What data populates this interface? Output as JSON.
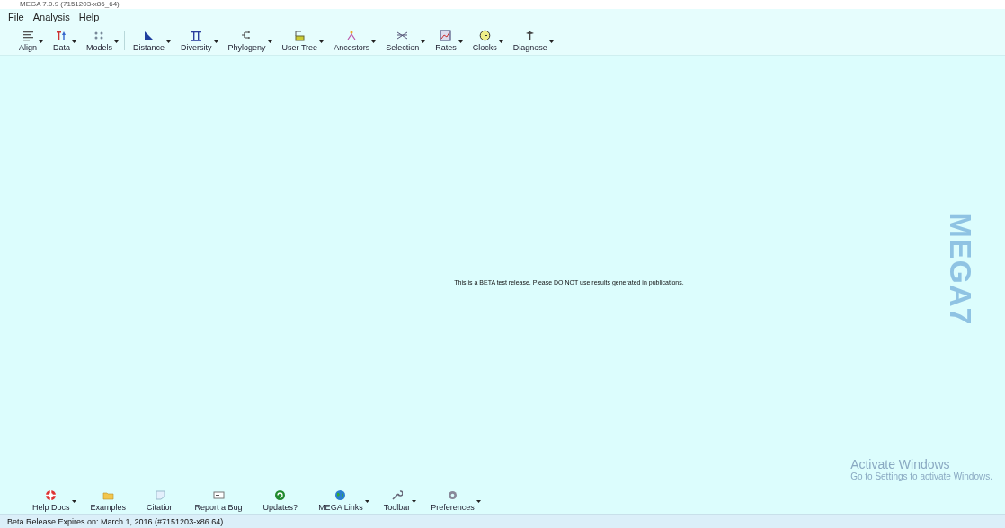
{
  "window": {
    "title": "MEGA 7.0.9 (7151203-x86_64)"
  },
  "menu": [
    "File",
    "Analysis",
    "Help"
  ],
  "toolbar": [
    {
      "label": "Align",
      "dropdown": true,
      "separator_after": false
    },
    {
      "label": "Data",
      "dropdown": true,
      "separator_after": false
    },
    {
      "label": "Models",
      "dropdown": true,
      "separator_after": true
    },
    {
      "label": "Distance",
      "dropdown": true,
      "separator_after": false
    },
    {
      "label": "Diversity",
      "dropdown": true,
      "separator_after": false
    },
    {
      "label": "Phylogeny",
      "dropdown": true,
      "separator_after": false
    },
    {
      "label": "User Tree",
      "dropdown": true,
      "separator_after": false
    },
    {
      "label": "Ancestors",
      "dropdown": true,
      "separator_after": false
    },
    {
      "label": "Selection",
      "dropdown": true,
      "separator_after": false
    },
    {
      "label": "Rates",
      "dropdown": true,
      "separator_after": false
    },
    {
      "label": "Clocks",
      "dropdown": true,
      "separator_after": false
    },
    {
      "label": "Diagnose",
      "dropdown": true,
      "separator_after": false
    }
  ],
  "notice": "This is a BETA test release. Please DO NOT use results generated in publications.",
  "logo": "MEGA7",
  "activation": {
    "title": "Activate Windows",
    "text": "Go to Settings to activate Windows."
  },
  "bottom_toolbar": [
    {
      "label": "Help Docs",
      "dropdown": true
    },
    {
      "label": "Examples",
      "dropdown": false
    },
    {
      "label": "Citation",
      "dropdown": false
    },
    {
      "label": "Report a Bug",
      "dropdown": false
    },
    {
      "label": "Updates?",
      "dropdown": false
    },
    {
      "label": "MEGA Links",
      "dropdown": true
    },
    {
      "label": "Toolbar",
      "dropdown": true
    },
    {
      "label": "Preferences",
      "dropdown": true
    }
  ],
  "status_bar": "Beta Release Expires on: March 1, 2016 (#7151203-x86  64)"
}
